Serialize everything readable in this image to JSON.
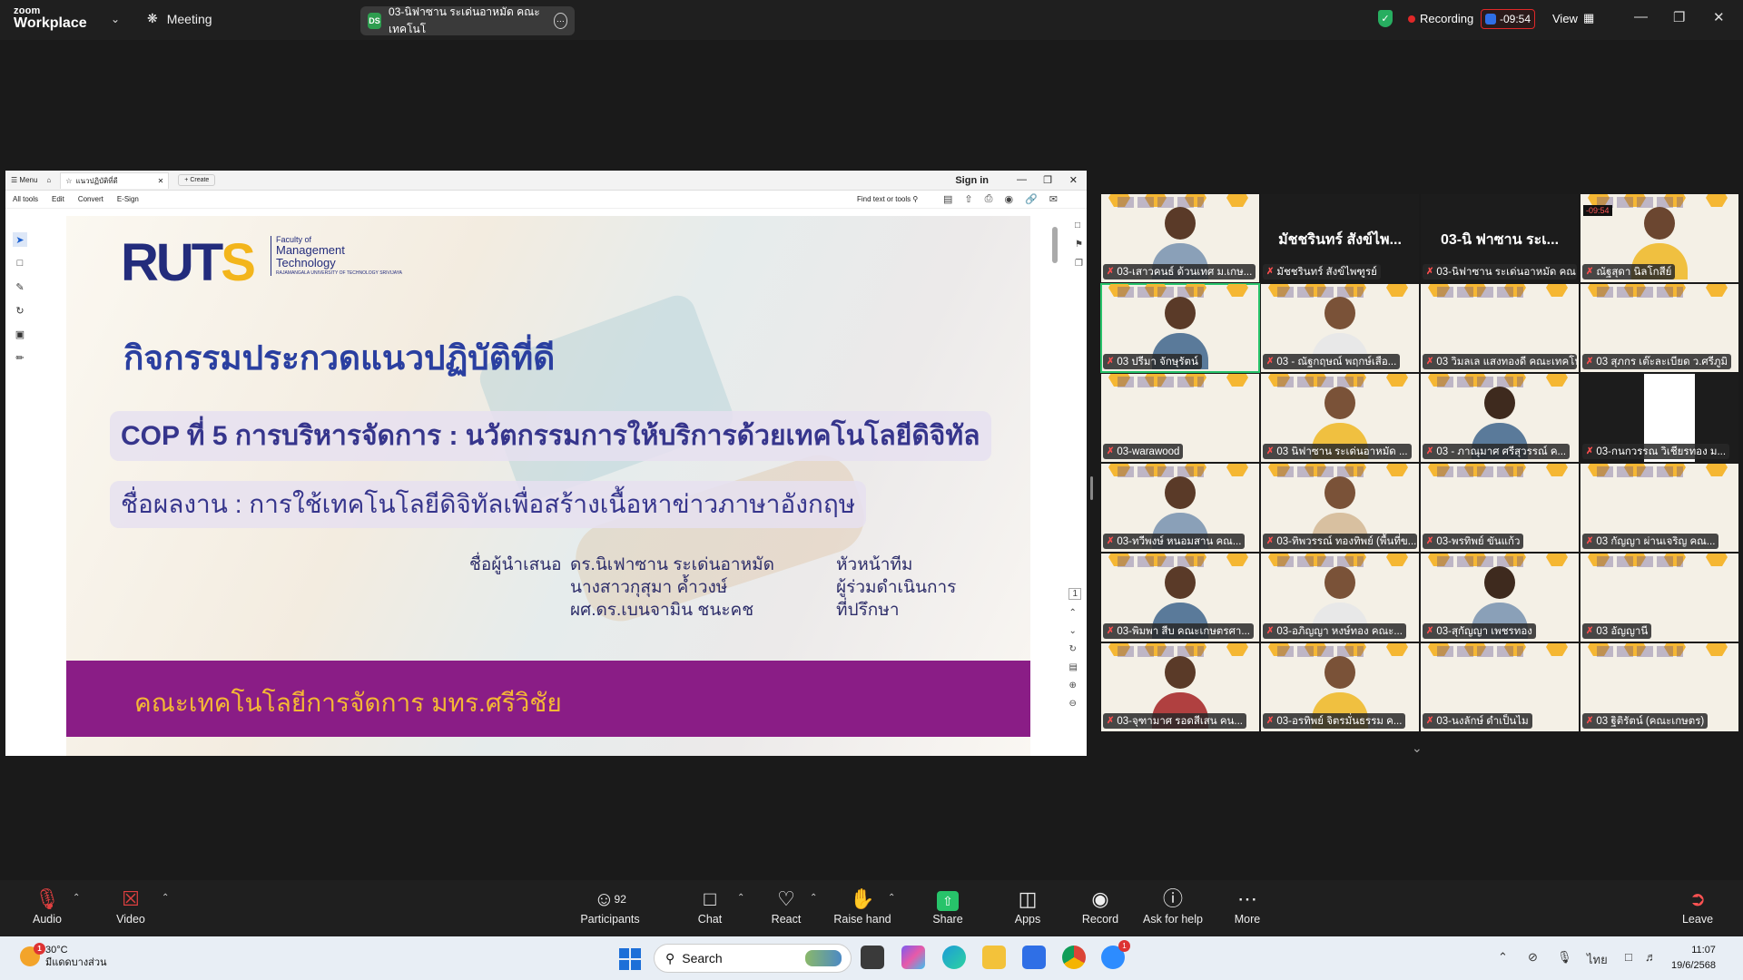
{
  "topbar": {
    "logo_line1": "zoom",
    "logo_line2": "Workplace",
    "meeting_label": "Meeting",
    "share_title": "03-นิฟาซาน ระเด่นอาหมัด คณะเทคโนโ",
    "share_badge": "DS",
    "recording_label": "Recording",
    "timer_text": "-09:54",
    "view_label": "View"
  },
  "pdf": {
    "menu_label": "Menu",
    "tab_title": "แนวปฏิบัติที่ดี",
    "create_label": "Create",
    "signin_label": "Sign in",
    "tools": [
      "All tools",
      "Edit",
      "Convert",
      "E-Sign"
    ],
    "find_label": "Find text or tools",
    "page_number": "1"
  },
  "slide": {
    "logo_text_a": "RUT",
    "logo_text_b": "S",
    "faculty_line1": "Faculty of",
    "faculty_line2": "Management",
    "faculty_line3": "Technology",
    "faculty_line4": "RAJAMANGALA UNIVERSITY OF TECHNOLOGY SRIVIJAYA",
    "title": "กิจกรรมประกวดแนวปฏิบัติที่ดี",
    "cop": "COP ที่ 5 การบริหารจัดการ : นวัตกรรมการให้บริการด้วยเทคโนโลยีดิจิทัล",
    "work": "ชื่อผลงาน : การใช้เทคโนโลยีดิจิทัลเพื่อสร้างเนื้อหาข่าวภาษาอังกฤษ",
    "presenter_label": "ชื่อผู้นำเสนอ",
    "presenters": [
      "ดร.นิเฟาซาน ระเด่นอาหมัด",
      "นางสาวกุสุมา ค้ำวงษ์",
      "ผศ.ดร.เบนจามิน ชนะคช"
    ],
    "roles": [
      "หัวหน้าทีม",
      "ผู้ร่วมดำเนินการ",
      "ที่ปรึกษา"
    ],
    "footer": "คณะเทคโนโลยีการจัดการ มทร.ศรีวิชัย"
  },
  "gallery": [
    {
      "name": "03-เสาวคนธ์ ด้วนเทศ ม.เกษ...",
      "kind": "person"
    },
    {
      "name": "มัชชรินทร์ สังข์ไพฑูรย์",
      "kind": "name",
      "big": "มัชชรินทร์ สังข์ไพ..."
    },
    {
      "name": "03-นิฟาซาน ระเด่นอาหมัด คณ...",
      "kind": "name",
      "big": "03-นิ ฟาซาน ระเ..."
    },
    {
      "name": "ณัฐสุดา นิลโกสีย์",
      "kind": "person",
      "timer": "-09:54"
    },
    {
      "name": "03 ปรีมา จักษุรัตน์",
      "kind": "person",
      "active": true
    },
    {
      "name": "03 - ณัฐกฤษณ์ พฤกษ์เสือ...",
      "kind": "person"
    },
    {
      "name": "03 วิมลเล แสงทองดี คณะเทคโน...",
      "kind": "slide"
    },
    {
      "name": "03 สุภกร เต๊ะละเบียด ว.ศรีภูมิ",
      "kind": "slide"
    },
    {
      "name": "03-warawood",
      "kind": "slide"
    },
    {
      "name": "03 นิฟาซาน ระเด่นอาหมัด ...",
      "kind": "person"
    },
    {
      "name": "03 - ภาณุมาศ ศรีสุวรรณ์ ค...",
      "kind": "person"
    },
    {
      "name": "03-กนกวรรณ วิเชียรทอง ม...",
      "kind": "dark"
    },
    {
      "name": "03-ทวีพงษ์ หนอมสาน คณ...",
      "kind": "person"
    },
    {
      "name": "03-ทิพวรรณ์ ทองทิพย์ (พื้นที่ข...",
      "kind": "person"
    },
    {
      "name": "03-พรทิพย์ ขันแก้ว",
      "kind": "slide"
    },
    {
      "name": "03 กัญญา ผ่านเจริญ คณ...",
      "kind": "slide"
    },
    {
      "name": "03-พิมพา สีบ คณะเกษตรศา...",
      "kind": "person"
    },
    {
      "name": "03-อภิญญา หงษ์ทอง คณะ...",
      "kind": "person"
    },
    {
      "name": "03-สุกัญญา เพชรทอง",
      "kind": "person"
    },
    {
      "name": "03 อัญญานี",
      "kind": "slide"
    },
    {
      "name": "03-จุฑามาศ รอดสีเสน คน...",
      "kind": "person"
    },
    {
      "name": "03-อรทิพย์ จิตรมั่นธรรม ค...",
      "kind": "person"
    },
    {
      "name": "03-นงลักษ์ ดำเป็นไม",
      "kind": "slide"
    },
    {
      "name": "03 ฐิติรัตน์ (คณะเกษตร)",
      "kind": "slide"
    }
  ],
  "controls": {
    "audio": "Audio",
    "video": "Video",
    "participants": "Participants",
    "participants_count": "92",
    "chat": "Chat",
    "react": "React",
    "raise_hand": "Raise hand",
    "share": "Share",
    "apps": "Apps",
    "record": "Record",
    "ask_help": "Ask for help",
    "more": "More",
    "leave": "Leave"
  },
  "taskbar": {
    "temp": "30°C",
    "weather_desc": "มีแดดบางส่วน",
    "weather_badge": "1",
    "search_label": "Search",
    "lang": "ไทย",
    "time": "11:07",
    "date": "19/6/2568",
    "zoom_badge": "1"
  },
  "colors": {
    "zoom_green": "#27c36a",
    "record_red": "#e02828",
    "slide_purple": "#8a1d86",
    "slide_blue": "#2a3fa0"
  }
}
